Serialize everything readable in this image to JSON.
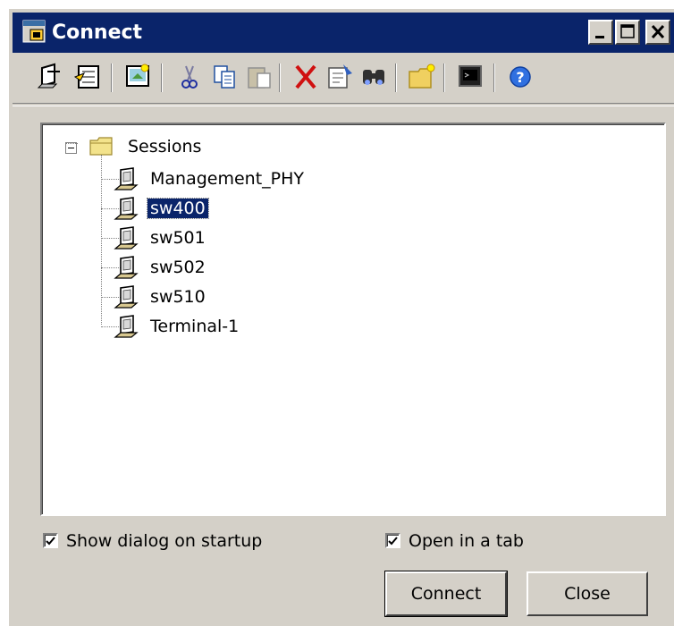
{
  "window": {
    "title": "Connect"
  },
  "title_buttons": [
    "minimize-icon",
    "maximize-icon",
    "close-icon"
  ],
  "toolbar": {
    "icons": [
      "connect-session-icon",
      "quick-connect-icon",
      "new-session-icon",
      "cut-icon",
      "copy-icon",
      "paste-icon",
      "delete-icon",
      "properties-icon",
      "find-icon",
      "new-folder-icon",
      "terminal-icon",
      "help-icon"
    ]
  },
  "tree": {
    "root": "Sessions",
    "items": [
      {
        "label": "Management_PHY",
        "selected": false
      },
      {
        "label": "sw400",
        "selected": true
      },
      {
        "label": "sw501",
        "selected": false
      },
      {
        "label": "sw502",
        "selected": false
      },
      {
        "label": "sw510",
        "selected": false
      },
      {
        "label": "Terminal-1",
        "selected": false
      }
    ]
  },
  "options": {
    "show_dialog": {
      "label": "Show dialog on startup",
      "checked": true
    },
    "open_in_tab": {
      "label": "Open in a tab",
      "checked": true
    }
  },
  "buttons": {
    "connect": "Connect",
    "close": "Close"
  },
  "colors": {
    "titlebar": "#0a246a",
    "face": "#d4d0c8",
    "selection": "#0a246a"
  }
}
